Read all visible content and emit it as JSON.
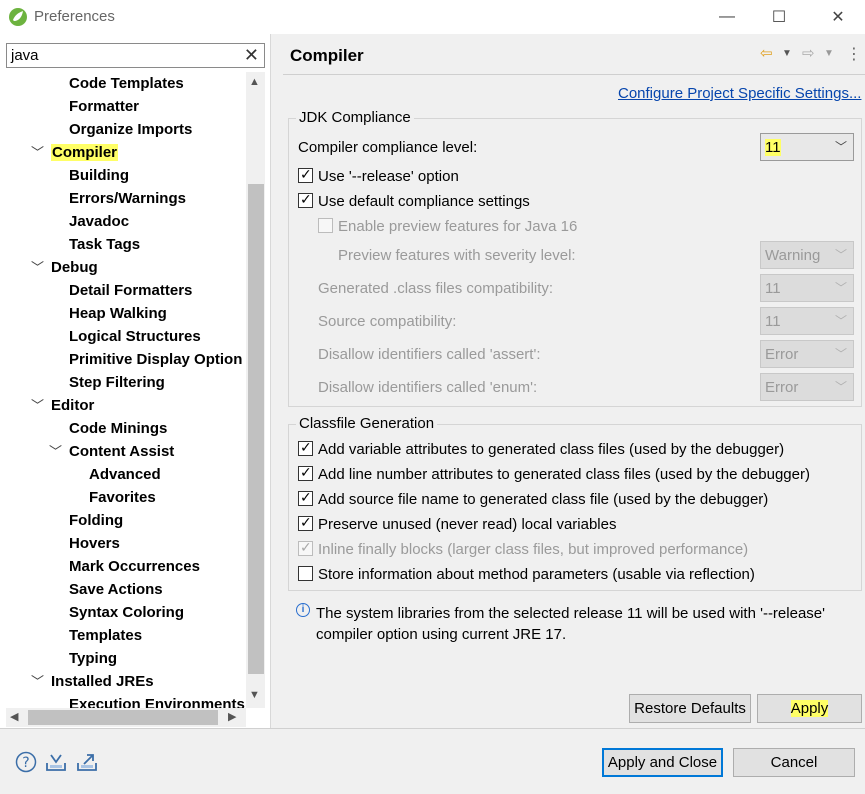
{
  "window": {
    "title": "Preferences",
    "minimize": "—",
    "maximize": "☐",
    "close": "✕"
  },
  "filter": {
    "value": "java",
    "clear": "✕"
  },
  "tree": [
    {
      "label": "Code Templates",
      "level": 3,
      "twisty": ""
    },
    {
      "label": "Formatter",
      "level": 3,
      "twisty": ""
    },
    {
      "label": "Organize Imports",
      "level": 3,
      "twisty": ""
    },
    {
      "label": "Compiler",
      "level": 2,
      "twisty": "open",
      "selected": true
    },
    {
      "label": "Building",
      "level": 3,
      "twisty": ""
    },
    {
      "label": "Errors/Warnings",
      "level": 3,
      "twisty": ""
    },
    {
      "label": "Javadoc",
      "level": 3,
      "twisty": ""
    },
    {
      "label": "Task Tags",
      "level": 3,
      "twisty": ""
    },
    {
      "label": "Debug",
      "level": 2,
      "twisty": "open"
    },
    {
      "label": "Detail Formatters",
      "level": 3,
      "twisty": ""
    },
    {
      "label": "Heap Walking",
      "level": 3,
      "twisty": ""
    },
    {
      "label": "Logical Structures",
      "level": 3,
      "twisty": ""
    },
    {
      "label": "Primitive Display Option",
      "level": 3,
      "twisty": ""
    },
    {
      "label": "Step Filtering",
      "level": 3,
      "twisty": ""
    },
    {
      "label": "Editor",
      "level": 2,
      "twisty": "open"
    },
    {
      "label": "Code Minings",
      "level": 3,
      "twisty": ""
    },
    {
      "label": "Content Assist",
      "level": 3,
      "twisty": "open"
    },
    {
      "label": "Advanced",
      "level": 4,
      "twisty": ""
    },
    {
      "label": "Favorites",
      "level": 4,
      "twisty": ""
    },
    {
      "label": "Folding",
      "level": 3,
      "twisty": ""
    },
    {
      "label": "Hovers",
      "level": 3,
      "twisty": ""
    },
    {
      "label": "Mark Occurrences",
      "level": 3,
      "twisty": ""
    },
    {
      "label": "Save Actions",
      "level": 3,
      "twisty": ""
    },
    {
      "label": "Syntax Coloring",
      "level": 3,
      "twisty": ""
    },
    {
      "label": "Templates",
      "level": 3,
      "twisty": ""
    },
    {
      "label": "Typing",
      "level": 3,
      "twisty": ""
    },
    {
      "label": "Installed JREs",
      "level": 2,
      "twisty": "open"
    },
    {
      "label": "Execution Environments",
      "level": 3,
      "twisty": ""
    }
  ],
  "page": {
    "title": "Compiler",
    "configure_link": "Configure Project Specific Settings..."
  },
  "jdk": {
    "group_title": "JDK Compliance",
    "compliance_label": "Compiler compliance level:",
    "compliance_value": "11",
    "use_release": {
      "label": "Use '--release' option",
      "checked": true
    },
    "use_default": {
      "label": "Use default compliance settings",
      "checked": true
    },
    "enable_preview": {
      "label": "Enable preview features for Java 16",
      "checked": false
    },
    "preview_severity_label": "Preview features with severity level:",
    "preview_severity_value": "Warning",
    "generated_label": "Generated .class files compatibility:",
    "generated_value": "11",
    "source_label": "Source compatibility:",
    "source_value": "11",
    "assert_label": "Disallow identifiers called 'assert':",
    "assert_value": "Error",
    "enum_label": "Disallow identifiers called 'enum':",
    "enum_value": "Error"
  },
  "classfile": {
    "group_title": "Classfile Generation",
    "options": [
      {
        "label": "Add variable attributes to generated class files (used by the debugger)",
        "checked": true,
        "disabled": false
      },
      {
        "label": "Add line number attributes to generated class files (used by the debugger)",
        "checked": true,
        "disabled": false
      },
      {
        "label": "Add source file name to generated class file (used by the debugger)",
        "checked": true,
        "disabled": false
      },
      {
        "label": "Preserve unused (never read) local variables",
        "checked": true,
        "disabled": false
      },
      {
        "label": "Inline finally blocks (larger class files, but improved performance)",
        "checked": true,
        "disabled": true
      },
      {
        "label": "Store information about method parameters (usable via reflection)",
        "checked": false,
        "disabled": false
      }
    ]
  },
  "info": {
    "line1": "The system libraries from the selected release 11 will be used with '--release'",
    "line2": "compiler option using current JRE 17."
  },
  "buttons": {
    "restore_defaults": "Restore Defaults",
    "apply": "Apply",
    "apply_and_close": "Apply and Close",
    "cancel": "Cancel"
  },
  "colors": {
    "highlight": "#ffff66",
    "link": "#0645ad",
    "primary_border": "#0078d7"
  }
}
